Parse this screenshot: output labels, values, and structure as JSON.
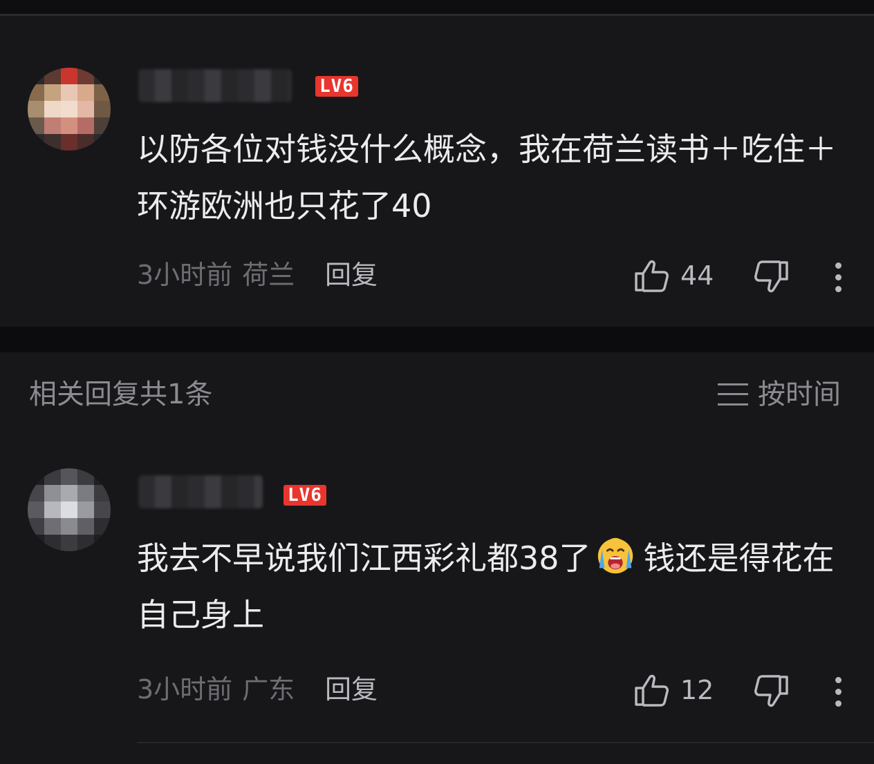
{
  "comments": [
    {
      "level_badge": "LV6",
      "text": "以防各位对钱没什么概念，我在荷兰读书＋吃住＋环游欧洲也只花了40",
      "time": "3小时前",
      "location": "荷兰",
      "reply_label": "回复",
      "like_count": "44",
      "avatar_colors": [
        "#c9362e",
        "#e8c7b4",
        "#8a6a4d"
      ]
    },
    {
      "level_badge": "LV6",
      "text_before_emoji": "我去不早说我们江西彩礼都38了",
      "emoji": "crying-face-emoji",
      "text_after_emoji": "钱还是得花在自己身上",
      "time": "3小时前",
      "location": "广东",
      "reply_label": "回复",
      "like_count": "12",
      "avatar_colors": [
        "#6e6e74",
        "#c8c8cf",
        "#3b3b40"
      ]
    }
  ],
  "related": {
    "title": "相关回复共1条",
    "sort_label": "按时间"
  },
  "icons": {
    "like": "thumbs-up-icon",
    "dislike": "thumbs-down-icon",
    "more": "more-vertical-icon",
    "sort": "sort-lines-icon"
  }
}
